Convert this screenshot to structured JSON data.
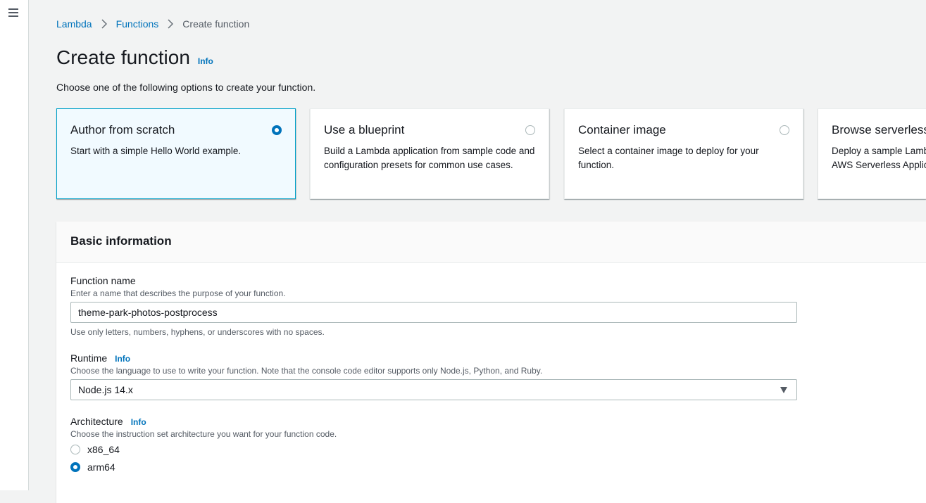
{
  "nav": {
    "menu_icon": "hamburger-menu-icon"
  },
  "breadcrumb": {
    "items": [
      "Lambda",
      "Functions"
    ],
    "current": "Create function",
    "separator_icon": "chevron-right-icon"
  },
  "page": {
    "title": "Create function",
    "info": "Info",
    "subtitle": "Choose one of the following options to create your function."
  },
  "options": [
    {
      "title": "Author from scratch",
      "description": "Start with a simple Hello World example.",
      "selected": true
    },
    {
      "title": "Use a blueprint",
      "description": "Build a Lambda application from sample code and configuration presets for common use cases.",
      "selected": false
    },
    {
      "title": "Container image",
      "description": "Select a container image to deploy for your function.",
      "selected": false
    },
    {
      "title": "Browse serverless app repository",
      "description": "Deploy a sample Lambda application from the AWS Serverless Application Repository.",
      "selected": false
    }
  ],
  "basic_info": {
    "heading": "Basic information",
    "function_name": {
      "label": "Function name",
      "description": "Enter a name that describes the purpose of your function.",
      "value": "theme-park-photos-postprocess",
      "constraint": "Use only letters, numbers, hyphens, or underscores with no spaces."
    },
    "runtime": {
      "label": "Runtime",
      "info": "Info",
      "description": "Choose the language to use to write your function. Note that the console code editor supports only Node.js, Python, and Ruby.",
      "value": "Node.js 14.x",
      "caret_icon": "caret-down-icon"
    },
    "architecture": {
      "label": "Architecture",
      "info": "Info",
      "description": "Choose the instruction set architecture you want for your function code.",
      "options": [
        {
          "label": "x86_64",
          "selected": false
        },
        {
          "label": "arm64",
          "selected": true
        }
      ]
    }
  },
  "colors": {
    "accent": "#0073bb",
    "selected_card_bg": "#f1faff",
    "selected_card_border": "#00a1c9",
    "page_bg": "#f2f3f3"
  }
}
